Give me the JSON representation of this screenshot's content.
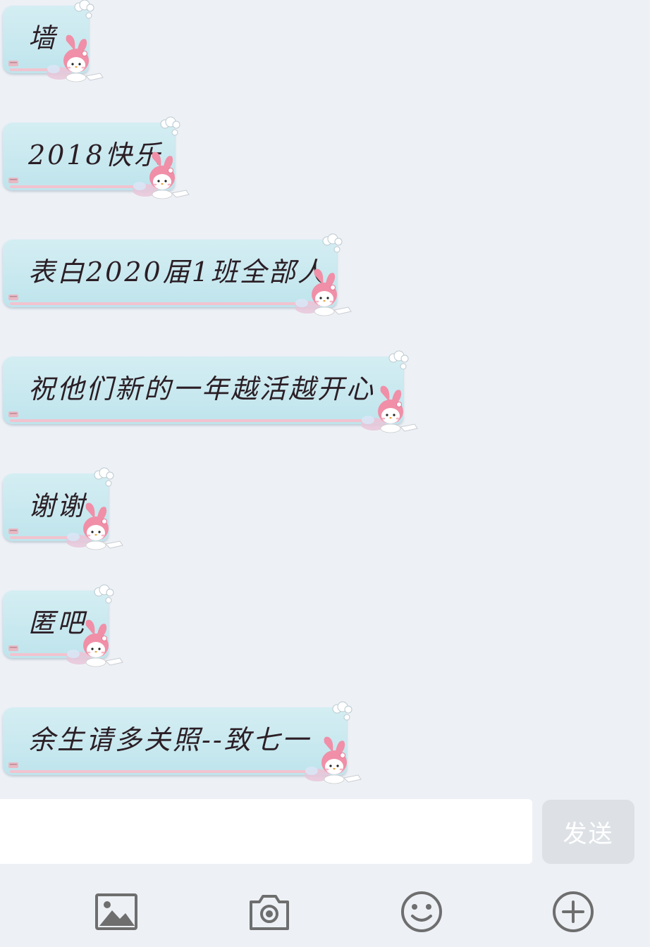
{
  "messages": [
    {
      "text": "墙"
    },
    {
      "text": "2018快乐"
    },
    {
      "text": "表白2020届1班全部人"
    },
    {
      "text": "祝他们新的一年越活越开心"
    },
    {
      "text": "谢谢"
    },
    {
      "text": "匿吧"
    },
    {
      "text": "余生请多关照--致七一"
    }
  ],
  "input": {
    "value": "",
    "placeholder": ""
  },
  "send_button": {
    "label": "发送"
  },
  "toolbar": {
    "icons": [
      "image-icon",
      "camera-icon",
      "emoji-icon",
      "plus-icon"
    ]
  },
  "colors": {
    "background": "#edf1f6",
    "bubble": "#c6e8ef",
    "bubble_stripe": "#f2c3cf",
    "text": "#2b1e25",
    "send_button": "#dde1e6",
    "icon": "#6e6e6e"
  }
}
